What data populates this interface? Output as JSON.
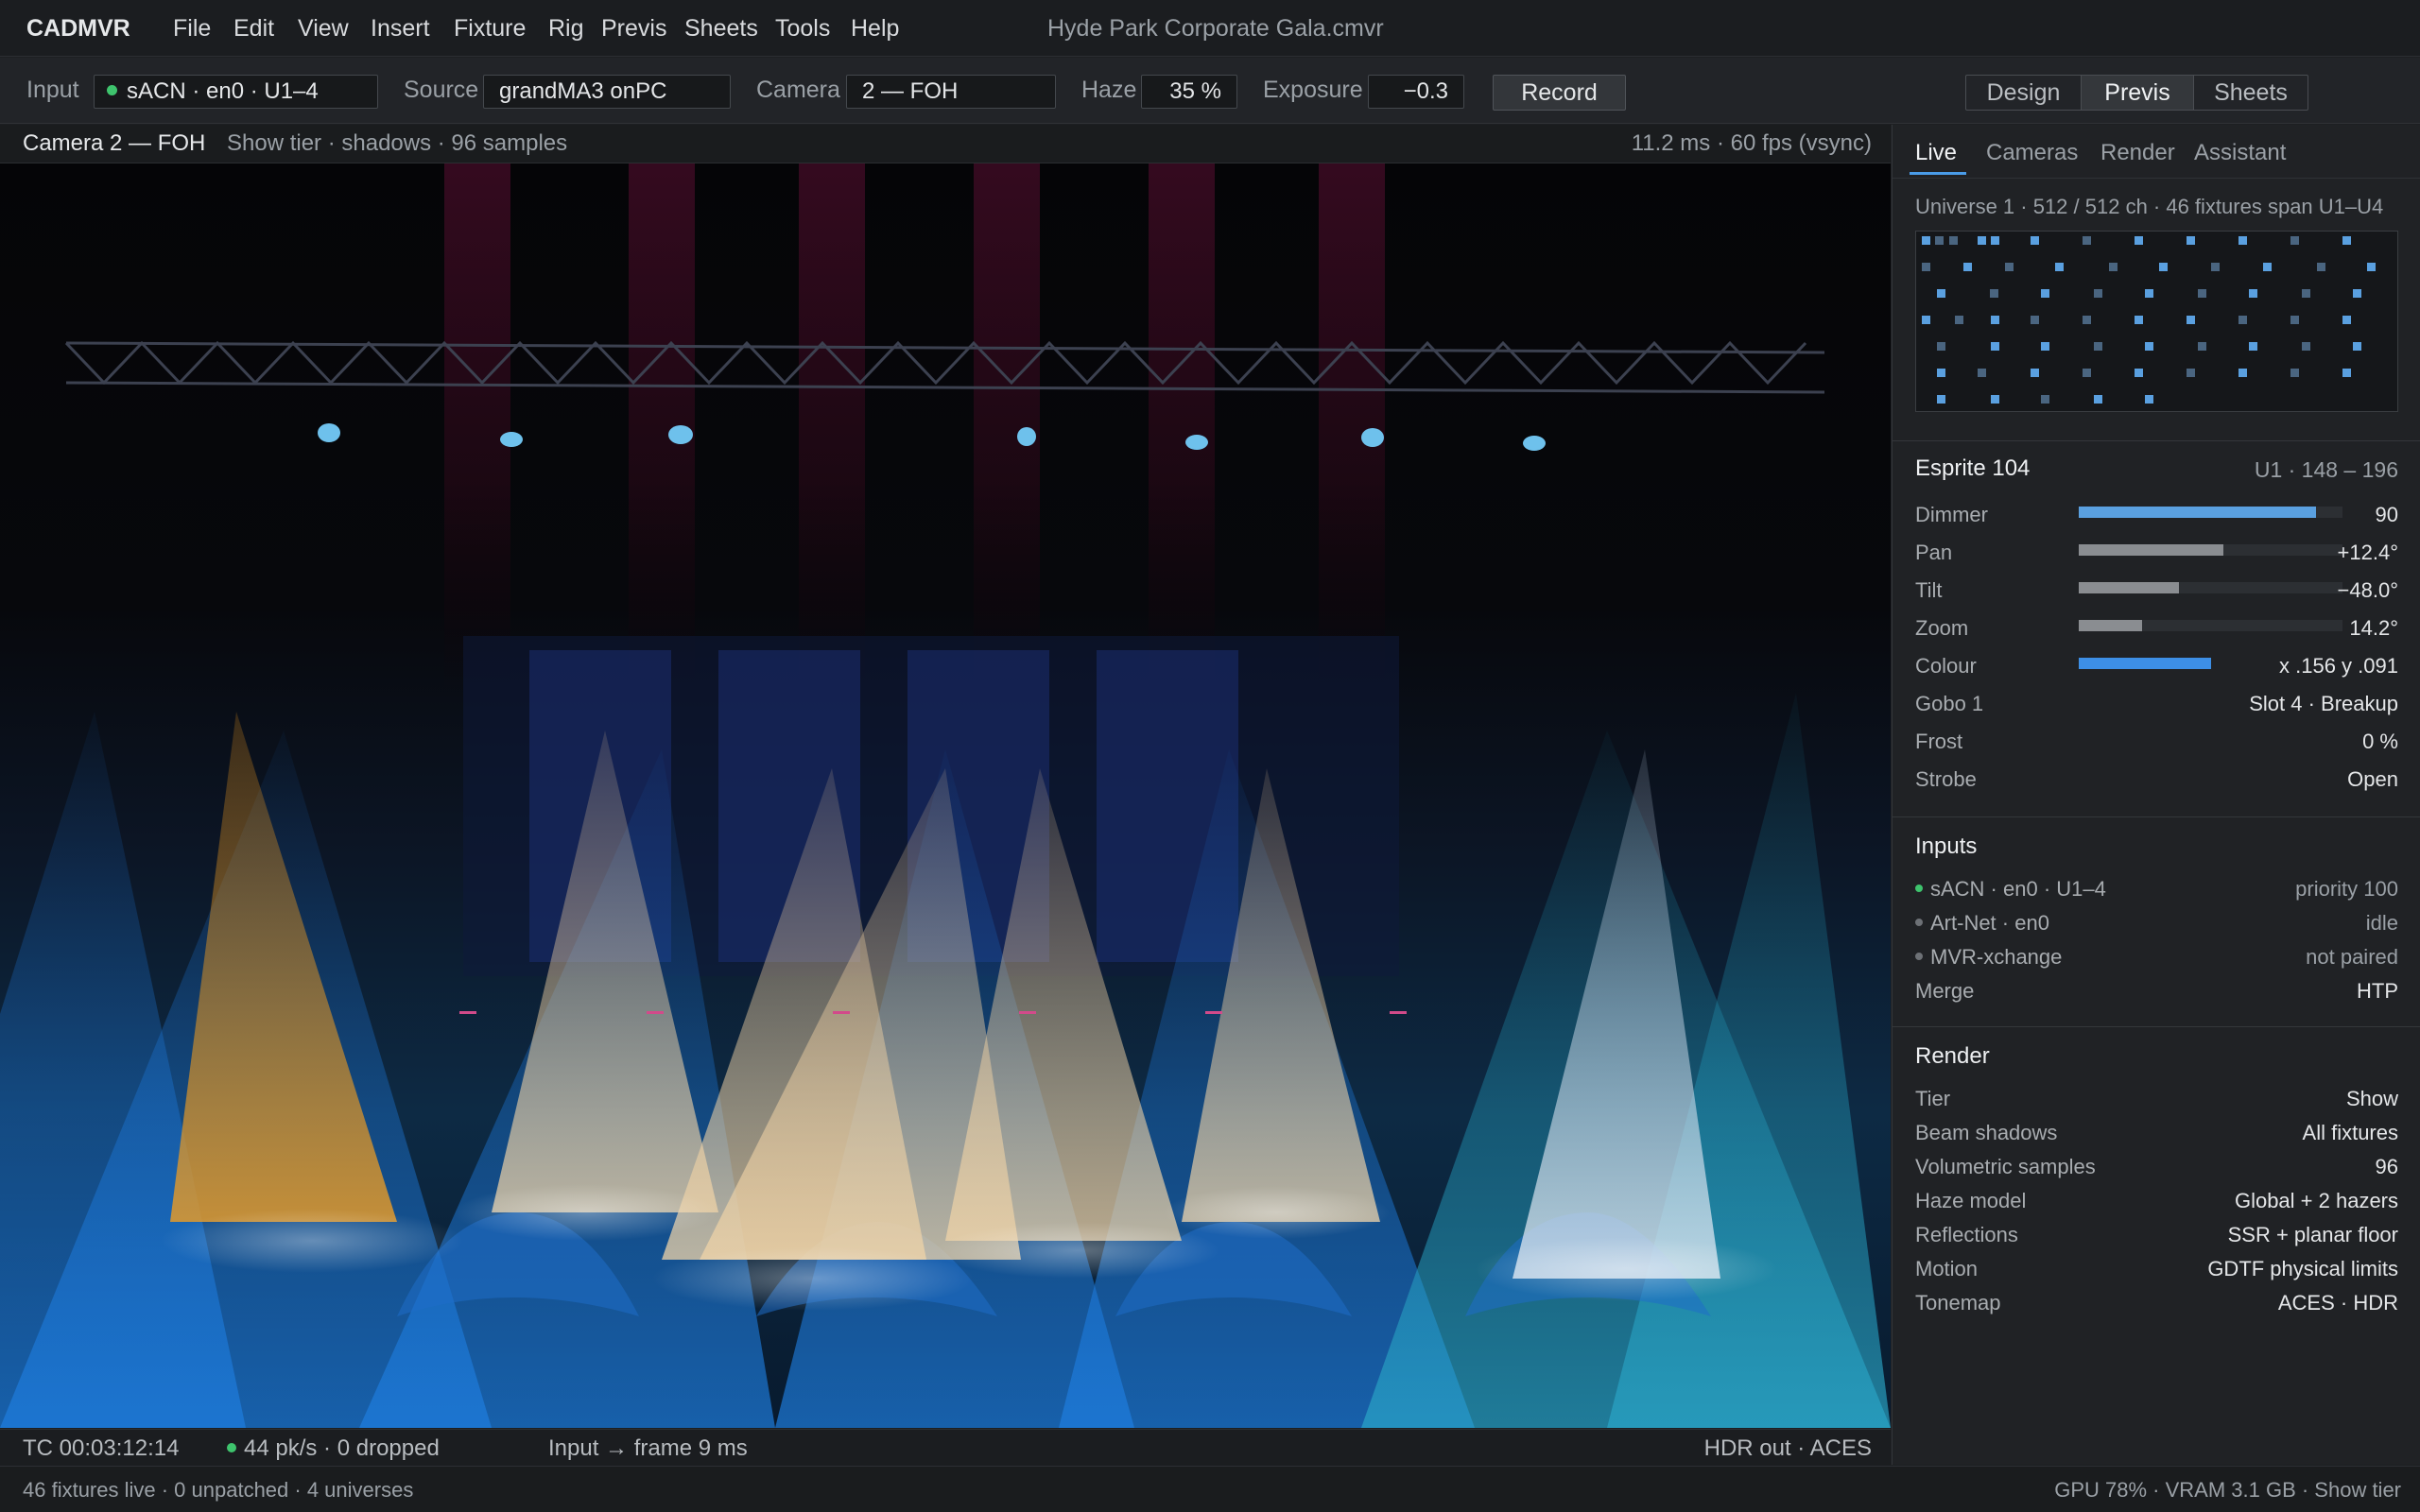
{
  "app": {
    "name": "CADMVR",
    "document_title": "Hyde Park Corporate Gala.cmvr"
  },
  "menu": [
    "File",
    "Edit",
    "View",
    "Insert",
    "Fixture",
    "Rig",
    "Previs",
    "Sheets",
    "Tools",
    "Help"
  ],
  "toolbar": {
    "input_label": "Input",
    "input_value": "sACN · en0 · U1–4",
    "source_label": "Source",
    "source_value": "grandMA3 onPC",
    "camera_label": "Camera",
    "camera_value": "2 — FOH",
    "haze_label": "Haze",
    "haze_value": "35 %",
    "exposure_label": "Exposure",
    "exposure_value": "−0.3",
    "record_label": "Record",
    "modes": [
      "Design",
      "Previs",
      "Sheets"
    ],
    "active_mode": "Previs"
  },
  "viewport": {
    "camera": "Camera 2 — FOH",
    "tier_info": "Show tier · shadows · 96 samples",
    "fps": "11.2 ms · 60 fps (vsync)",
    "footer": {
      "timecode": "TC 00:03:12:14",
      "packets": "44 pk/s · 0 dropped",
      "latency": "Input → frame 9 ms",
      "output": "HDR out · ACES"
    }
  },
  "side_panel": {
    "tabs": [
      "Live",
      "Cameras",
      "Render",
      "Assistant"
    ],
    "active_tab": "Live",
    "universe_info": "Universe 1 · 512 / 512 ch · 46 fixtures span U1–U4",
    "fixture": {
      "name": "Esprite 104",
      "address": "U1 · 148 – 196",
      "params": [
        {
          "label": "Dimmer",
          "value": "90",
          "level": 0.9,
          "color": "#5aa0e0"
        },
        {
          "label": "Pan",
          "value": "+12.4°",
          "level": 0.55,
          "color": "#8a8d91"
        },
        {
          "label": "Tilt",
          "value": "−48.0°",
          "level": 0.38,
          "color": "#8a8d91"
        },
        {
          "label": "Zoom",
          "value": "14.2°",
          "level": 0.24,
          "color": "#8a8d91"
        },
        {
          "label": "Colour",
          "value": "x .156 y .091",
          "level": 0.5,
          "color": "#3d8fe6"
        }
      ],
      "rows": [
        {
          "label": "Gobo 1",
          "value": "Slot 4 · Breakup"
        },
        {
          "label": "Frost",
          "value": "0 %"
        },
        {
          "label": "Strobe",
          "value": "Open"
        }
      ]
    },
    "inputs": {
      "title": "Inputs",
      "rows": [
        {
          "label": "sACN · en0 · U1–4",
          "value": "priority 100",
          "status": "active"
        },
        {
          "label": "Art-Net · en0",
          "value": "idle",
          "status": "inactive"
        },
        {
          "label": "MVR-xchange",
          "value": "not paired",
          "status": "inactive"
        },
        {
          "label": "Merge",
          "value": "HTP",
          "status": "none"
        }
      ]
    },
    "render": {
      "title": "Render",
      "rows": [
        {
          "label": "Tier",
          "value": "Show"
        },
        {
          "label": "Beam shadows",
          "value": "All fixtures"
        },
        {
          "label": "Volumetric samples",
          "value": "96"
        },
        {
          "label": "Haze model",
          "value": "Global + 2 hazers"
        },
        {
          "label": "Reflections",
          "value": "SSR + planar floor"
        },
        {
          "label": "Motion",
          "value": "GDTF physical limits"
        },
        {
          "label": "Tonemap",
          "value": "ACES · HDR"
        }
      ]
    }
  },
  "status_bar": {
    "left": "46 fixtures live · 0 unpatched · 4 universes",
    "right": "GPU 78% · VRAM 3.1 GB · Show tier"
  },
  "colors": {
    "accent": "#4a9ce8",
    "ok": "#3ec46d",
    "bg": "#1d1f22"
  }
}
